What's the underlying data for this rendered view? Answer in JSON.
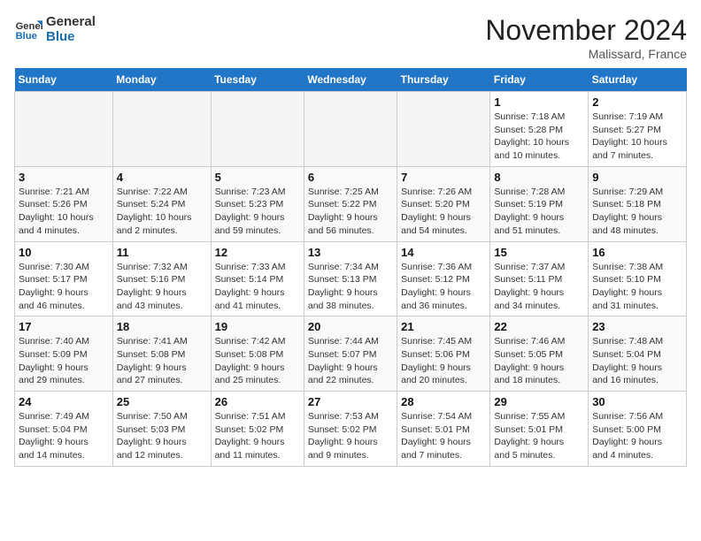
{
  "logo": {
    "line1": "General",
    "line2": "Blue"
  },
  "title": "November 2024",
  "location": "Malissard, France",
  "weekdays": [
    "Sunday",
    "Monday",
    "Tuesday",
    "Wednesday",
    "Thursday",
    "Friday",
    "Saturday"
  ],
  "weeks": [
    [
      {
        "day": "",
        "info": ""
      },
      {
        "day": "",
        "info": ""
      },
      {
        "day": "",
        "info": ""
      },
      {
        "day": "",
        "info": ""
      },
      {
        "day": "",
        "info": ""
      },
      {
        "day": "1",
        "info": "Sunrise: 7:18 AM\nSunset: 5:28 PM\nDaylight: 10 hours\nand 10 minutes."
      },
      {
        "day": "2",
        "info": "Sunrise: 7:19 AM\nSunset: 5:27 PM\nDaylight: 10 hours\nand 7 minutes."
      }
    ],
    [
      {
        "day": "3",
        "info": "Sunrise: 7:21 AM\nSunset: 5:26 PM\nDaylight: 10 hours\nand 4 minutes."
      },
      {
        "day": "4",
        "info": "Sunrise: 7:22 AM\nSunset: 5:24 PM\nDaylight: 10 hours\nand 2 minutes."
      },
      {
        "day": "5",
        "info": "Sunrise: 7:23 AM\nSunset: 5:23 PM\nDaylight: 9 hours\nand 59 minutes."
      },
      {
        "day": "6",
        "info": "Sunrise: 7:25 AM\nSunset: 5:22 PM\nDaylight: 9 hours\nand 56 minutes."
      },
      {
        "day": "7",
        "info": "Sunrise: 7:26 AM\nSunset: 5:20 PM\nDaylight: 9 hours\nand 54 minutes."
      },
      {
        "day": "8",
        "info": "Sunrise: 7:28 AM\nSunset: 5:19 PM\nDaylight: 9 hours\nand 51 minutes."
      },
      {
        "day": "9",
        "info": "Sunrise: 7:29 AM\nSunset: 5:18 PM\nDaylight: 9 hours\nand 48 minutes."
      }
    ],
    [
      {
        "day": "10",
        "info": "Sunrise: 7:30 AM\nSunset: 5:17 PM\nDaylight: 9 hours\nand 46 minutes."
      },
      {
        "day": "11",
        "info": "Sunrise: 7:32 AM\nSunset: 5:16 PM\nDaylight: 9 hours\nand 43 minutes."
      },
      {
        "day": "12",
        "info": "Sunrise: 7:33 AM\nSunset: 5:14 PM\nDaylight: 9 hours\nand 41 minutes."
      },
      {
        "day": "13",
        "info": "Sunrise: 7:34 AM\nSunset: 5:13 PM\nDaylight: 9 hours\nand 38 minutes."
      },
      {
        "day": "14",
        "info": "Sunrise: 7:36 AM\nSunset: 5:12 PM\nDaylight: 9 hours\nand 36 minutes."
      },
      {
        "day": "15",
        "info": "Sunrise: 7:37 AM\nSunset: 5:11 PM\nDaylight: 9 hours\nand 34 minutes."
      },
      {
        "day": "16",
        "info": "Sunrise: 7:38 AM\nSunset: 5:10 PM\nDaylight: 9 hours\nand 31 minutes."
      }
    ],
    [
      {
        "day": "17",
        "info": "Sunrise: 7:40 AM\nSunset: 5:09 PM\nDaylight: 9 hours\nand 29 minutes."
      },
      {
        "day": "18",
        "info": "Sunrise: 7:41 AM\nSunset: 5:08 PM\nDaylight: 9 hours\nand 27 minutes."
      },
      {
        "day": "19",
        "info": "Sunrise: 7:42 AM\nSunset: 5:08 PM\nDaylight: 9 hours\nand 25 minutes."
      },
      {
        "day": "20",
        "info": "Sunrise: 7:44 AM\nSunset: 5:07 PM\nDaylight: 9 hours\nand 22 minutes."
      },
      {
        "day": "21",
        "info": "Sunrise: 7:45 AM\nSunset: 5:06 PM\nDaylight: 9 hours\nand 20 minutes."
      },
      {
        "day": "22",
        "info": "Sunrise: 7:46 AM\nSunset: 5:05 PM\nDaylight: 9 hours\nand 18 minutes."
      },
      {
        "day": "23",
        "info": "Sunrise: 7:48 AM\nSunset: 5:04 PM\nDaylight: 9 hours\nand 16 minutes."
      }
    ],
    [
      {
        "day": "24",
        "info": "Sunrise: 7:49 AM\nSunset: 5:04 PM\nDaylight: 9 hours\nand 14 minutes."
      },
      {
        "day": "25",
        "info": "Sunrise: 7:50 AM\nSunset: 5:03 PM\nDaylight: 9 hours\nand 12 minutes."
      },
      {
        "day": "26",
        "info": "Sunrise: 7:51 AM\nSunset: 5:02 PM\nDaylight: 9 hours\nand 11 minutes."
      },
      {
        "day": "27",
        "info": "Sunrise: 7:53 AM\nSunset: 5:02 PM\nDaylight: 9 hours\nand 9 minutes."
      },
      {
        "day": "28",
        "info": "Sunrise: 7:54 AM\nSunset: 5:01 PM\nDaylight: 9 hours\nand 7 minutes."
      },
      {
        "day": "29",
        "info": "Sunrise: 7:55 AM\nSunset: 5:01 PM\nDaylight: 9 hours\nand 5 minutes."
      },
      {
        "day": "30",
        "info": "Sunrise: 7:56 AM\nSunset: 5:00 PM\nDaylight: 9 hours\nand 4 minutes."
      }
    ]
  ]
}
